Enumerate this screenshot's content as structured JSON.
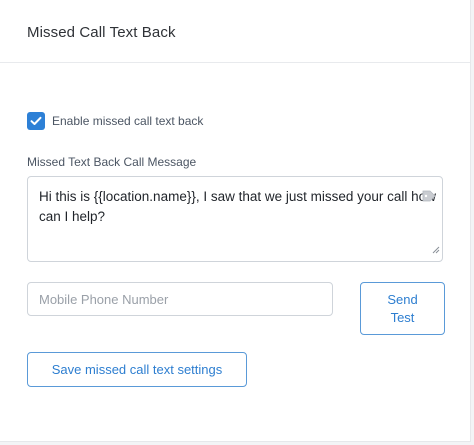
{
  "header": {
    "title": "Missed Call Text Back"
  },
  "enable_checkbox": {
    "label": "Enable missed call text back",
    "checked": true,
    "accent_color": "#2d80d6"
  },
  "message": {
    "label": "Missed Text Back Call Message",
    "value": "Hi this is {{location.name}}, I saw that we just missed your call how can I help?",
    "tag_icon": "tag-icon",
    "resize_icon": "resize-handle-icon"
  },
  "phone": {
    "placeholder": "Mobile Phone Number",
    "value": ""
  },
  "send_test": {
    "line1": "Send",
    "line2": "Test"
  },
  "save_button": {
    "label": "Save missed call text settings"
  },
  "colors": {
    "primary": "#2d7ed0",
    "border": "#cfd4da"
  }
}
